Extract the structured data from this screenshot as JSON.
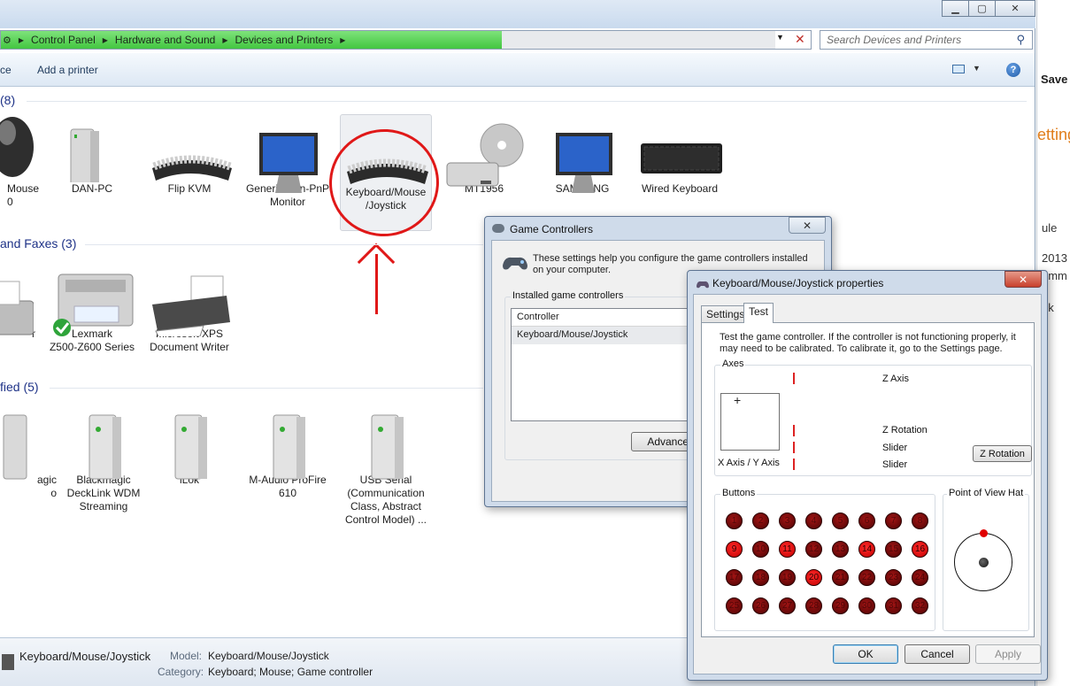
{
  "explorer": {
    "breadcrumb": [
      "Control Panel",
      "Hardware and Sound",
      "Devices and Printers"
    ],
    "search_placeholder": "Search Devices and Printers",
    "toolbar": {
      "partial_item": "ce",
      "add_printer": "Add a printer"
    },
    "sections": {
      "devices": "(8)",
      "printers": "and Faxes (3)",
      "unspecified": "fied (5)"
    },
    "devices": [
      {
        "label": "Mouse\n0"
      },
      {
        "label": "DAN-PC"
      },
      {
        "label": "Flip KVM"
      },
      {
        "label": "Generic Non-PnP\nMonitor"
      },
      {
        "label": "Keyboard/Mouse\n/Joystick"
      },
      {
        "label": "MT1956"
      },
      {
        "label": "SAMSUNG"
      },
      {
        "label": "Wired Keyboard"
      }
    ],
    "printers": [
      {
        "label": "r"
      },
      {
        "label": "Lexmark\nZ500-Z600 Series"
      },
      {
        "label": "Microsoft XPS\nDocument Writer"
      }
    ],
    "unspecified": [
      {
        "label": "agic\no"
      },
      {
        "label": "Blackmagic\nDeckLink WDM\nStreaming"
      },
      {
        "label": "iLok"
      },
      {
        "label": "M-Audio ProFire\n610"
      },
      {
        "label": "USB Serial\n(Communication\nClass, Abstract\nControl Model) ..."
      }
    ],
    "details": {
      "name": "Keyboard/Mouse/Joystick",
      "model_key": "Model:",
      "model_val": "Keyboard/Mouse/Joystick",
      "category_key": "Category:",
      "category_val": "Keyboard; Mouse; Game controller"
    }
  },
  "rightstrip": {
    "save": "Save",
    "settings_partial": "etting",
    "lines": [
      "ule",
      "2013",
      "umm",
      "ok"
    ]
  },
  "game_controllers": {
    "title": "Game Controllers",
    "description": "These settings help you configure the game controllers installed on your computer.",
    "group_label": "Installed game controllers",
    "column_header": "Controller",
    "items": [
      "Keyboard/Mouse/Joystick"
    ],
    "advanced_button": "Advanced"
  },
  "properties": {
    "title": "Keyboard/Mouse/Joystick properties",
    "tabs": [
      "Settings",
      "Test"
    ],
    "active_tab": "Test",
    "instructions": "Test the game controller.  If the controller is not functioning properly, it may need to be calibrated.  To calibrate it, go to the Settings page.",
    "axes_label": "Axes",
    "xy_label": "X Axis / Y Axis",
    "z_axis": "Z Axis",
    "z_rotation": "Z Rotation",
    "slider1": "Slider",
    "slider2": "Slider",
    "z_rotation_button": "Z Rotation",
    "buttons_label": "Buttons",
    "pov_label": "Point of View Hat",
    "buttons": [
      {
        "n": "1",
        "lit": false
      },
      {
        "n": "2",
        "lit": false
      },
      {
        "n": "3",
        "lit": false
      },
      {
        "n": "4",
        "lit": false
      },
      {
        "n": "5",
        "lit": false
      },
      {
        "n": "6",
        "lit": false
      },
      {
        "n": "7",
        "lit": false
      },
      {
        "n": "8",
        "lit": false
      },
      {
        "n": "9",
        "lit": true
      },
      {
        "n": "10",
        "lit": false
      },
      {
        "n": "11",
        "lit": true
      },
      {
        "n": "12",
        "lit": false
      },
      {
        "n": "13",
        "lit": false
      },
      {
        "n": "14",
        "lit": true
      },
      {
        "n": "15",
        "lit": false
      },
      {
        "n": "16",
        "lit": true
      },
      {
        "n": "17",
        "lit": false
      },
      {
        "n": "18",
        "lit": false
      },
      {
        "n": "19",
        "lit": false
      },
      {
        "n": "20",
        "lit": true
      },
      {
        "n": "21",
        "lit": false
      },
      {
        "n": "22",
        "lit": false
      },
      {
        "n": "23",
        "lit": false
      },
      {
        "n": "24",
        "lit": false
      },
      {
        "n": "25",
        "lit": false
      },
      {
        "n": "26",
        "lit": false
      },
      {
        "n": "27",
        "lit": false
      },
      {
        "n": "28",
        "lit": false
      },
      {
        "n": "29",
        "lit": false
      },
      {
        "n": "30",
        "lit": false
      },
      {
        "n": "31",
        "lit": false
      },
      {
        "n": "32",
        "lit": false
      }
    ],
    "ok": "OK",
    "cancel": "Cancel",
    "apply": "Apply"
  },
  "colors": {
    "accent_red": "#e01818",
    "explorer_bg": "#ffffff",
    "progress_green": "#4ccb49"
  }
}
